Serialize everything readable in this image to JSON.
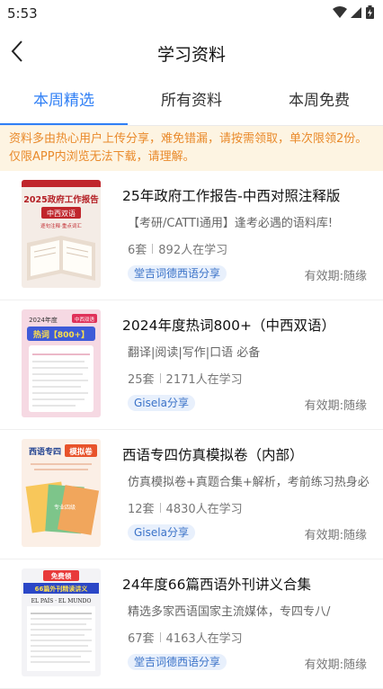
{
  "status_bar": {
    "time": "5:53"
  },
  "header": {
    "title": "学习资料"
  },
  "tabs": [
    {
      "label": "本周精选",
      "active": true
    },
    {
      "label": "所有资料",
      "active": false
    },
    {
      "label": "本周免费",
      "active": false
    }
  ],
  "notice": {
    "line1": "资料多由热心用户上传分享，难免错漏，请按需领取，单次限领2份。",
    "line2": "仅限APP内浏览无法下载，请理解。"
  },
  "items": [
    {
      "title": "25年政府工作报告-中西对照注释版",
      "desc": "【考研/CATTI通用】逢考必遇的语料库!",
      "sets": "6套",
      "learners": "892人在学习",
      "tag": "堂吉词德西语分享",
      "validity": "有效期:随缘",
      "cover": {
        "top_text": "2025政府工作报告",
        "mid_text": "中西双语",
        "sub_text": "逐句注释·重点词汇"
      }
    },
    {
      "title": "2024年度热词800+（中西双语）",
      "desc": "翻译|阅读|写作|口语 必备",
      "sets": "25套",
      "learners": "2171人在学习",
      "tag": "Gisela分享",
      "validity": "有效期:随缘",
      "cover": {
        "top_text": "2024年度",
        "mid_text": "热词【800+】",
        "sub_text": "中西双语"
      }
    },
    {
      "title": "西语专四仿真模拟卷（内部）",
      "desc": "仿真模拟卷+真题合集+解析，考前练习热身必",
      "sets": "12套",
      "learners": "4830人在学习",
      "tag": "Gisela分享",
      "validity": "有效期:随缘",
      "cover": {
        "top_text": "西语专四",
        "mid_text": "模拟卷",
        "sub_text": "专业四级"
      }
    },
    {
      "title": "24年度66篇西语外刊讲义合集",
      "desc": "精选多家西语国家主流媒体，专四专八/",
      "sets": "67套",
      "learners": "4163人在学习",
      "tag": "堂吉词德西语分享",
      "validity": "有效期:随缘",
      "cover": {
        "top_text": "免费领",
        "mid_text": "66篇外刊精读讲义",
        "sub_text": "EL PAÍS · EL MUNDO"
      }
    }
  ],
  "colors": {
    "accent": "#2f7ff5",
    "notice_text": "#e98a2b",
    "notice_bg": "#fdf4e2"
  }
}
